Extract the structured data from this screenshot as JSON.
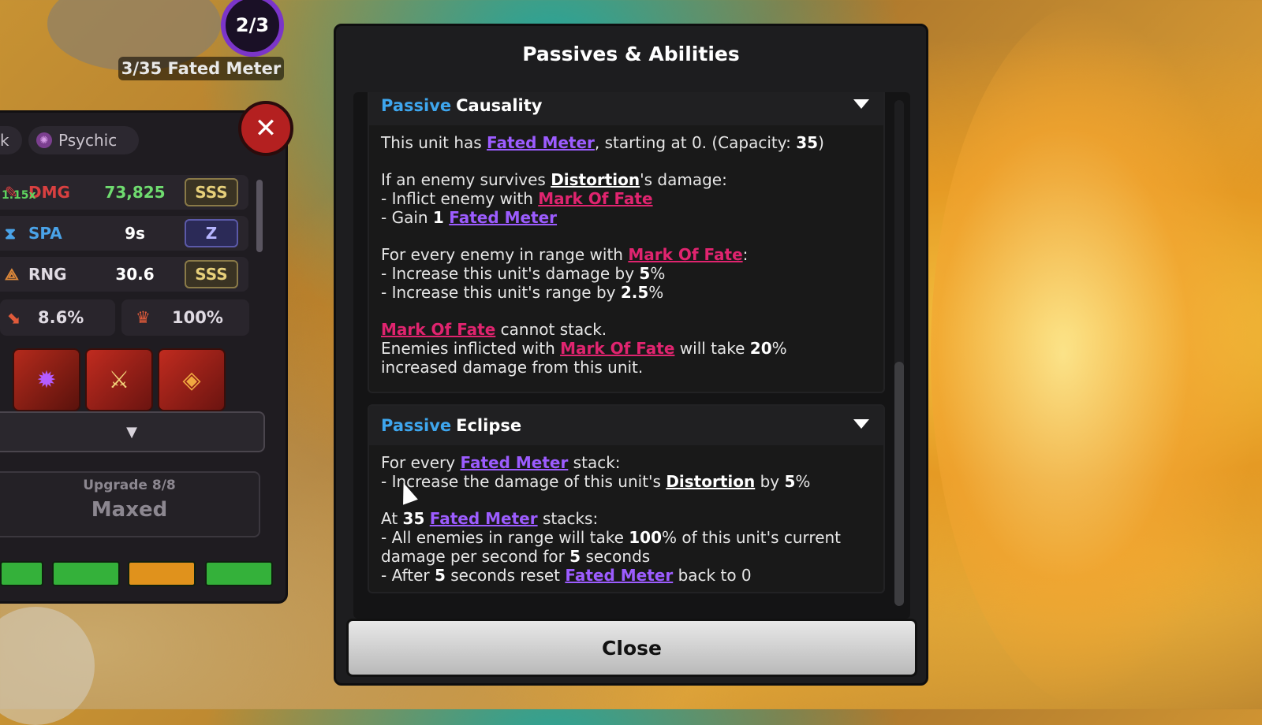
{
  "hud": {
    "wave_counter": "2/3",
    "meter_label": "3/35 Fated Meter"
  },
  "unit_panel": {
    "element_left_partial": "k",
    "element": "Psychic",
    "stats": [
      {
        "multiplier": "1.15x",
        "name": "DMG",
        "value": "73,825",
        "rank": "SSS"
      },
      {
        "name": "SPA",
        "value": "9s",
        "rank": "Z"
      },
      {
        "name": "RNG",
        "value": "30.6",
        "rank": "SSS"
      }
    ],
    "crit_chance": "8.6%",
    "crit_damage": "100%",
    "upgrade_label": "Upgrade 8/8",
    "upgrade_status": "Maxed",
    "colors": {
      "rank_sss": "#e6cf7a",
      "rank_z": "#b6b5ff"
    }
  },
  "modal": {
    "title": "Passives & Abilities",
    "close_label": "Close",
    "sections": [
      {
        "tag": "Passive",
        "name": "Causality",
        "lines": {
          "l1a": "This unit has ",
          "l1b": "Fated Meter",
          "l1c": ", starting at 0. (Capacity: ",
          "l1d": "35",
          "l1e": ")",
          "l2a": "If an enemy survives ",
          "l2b": "Distortion",
          "l2c": "'s damage:",
          "l3a": "- Inflict enemy with ",
          "l3b": "Mark Of Fate",
          "l4a": "- Gain ",
          "l4b": "1",
          "l4c": "Fated Meter",
          "l5a": "For every enemy in range with ",
          "l5b": "Mark Of Fate",
          "l5c": ":",
          "l6a": "- Increase this unit's damage by ",
          "l6b": "5",
          "l6c": "%",
          "l7a": "- Increase this unit's range by ",
          "l7b": "2.5",
          "l7c": "%",
          "l8a": "Mark Of Fate",
          "l8b": " cannot stack.",
          "l9a": "Enemies inflicted with ",
          "l9b": "Mark Of Fate",
          "l9c": " will take ",
          "l9d": "20",
          "l9e": "%",
          "l10": "increased damage from this unit."
        }
      },
      {
        "tag": "Passive",
        "name": "Eclipse",
        "lines": {
          "l1a": "For every ",
          "l1b": "Fated Meter",
          "l1c": " stack:",
          "l2a": "- Increase the damage of this unit's ",
          "l2b": "Distortion",
          "l2c": " by ",
          "l2d": "5",
          "l2e": "%",
          "l3a": "At ",
          "l3b": "35",
          "l3c": "Fated Meter",
          "l3d": " stacks:",
          "l4a": "- All enemies in range will take ",
          "l4b": "100",
          "l4c": "% of this unit's current",
          "l5a": "damage per second for ",
          "l5b": "5",
          "l5c": " seconds",
          "l6a": "- After ",
          "l6b": "5",
          "l6c": " seconds reset ",
          "l6d": "Fated Meter",
          "l6e": " back to 0"
        }
      }
    ],
    "colors": {
      "passive_tag": "#3ea6ee",
      "fated_meter": "#9c5cff",
      "mark_of_fate": "#e0246f"
    }
  }
}
